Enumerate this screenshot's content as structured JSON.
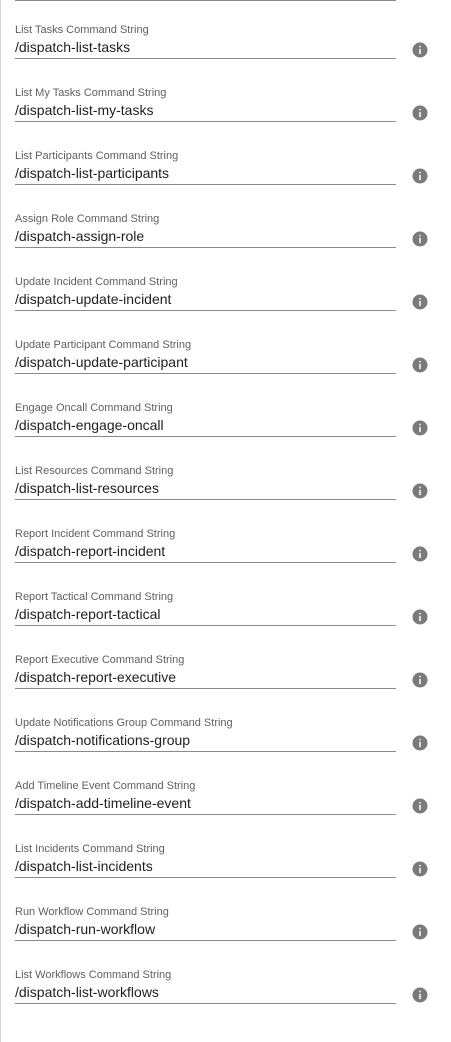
{
  "fields": [
    {
      "label": "List Tasks Command String",
      "value": "/dispatch-list-tasks"
    },
    {
      "label": "List My Tasks Command String",
      "value": "/dispatch-list-my-tasks"
    },
    {
      "label": "List Participants Command String",
      "value": "/dispatch-list-participants"
    },
    {
      "label": "Assign Role Command String",
      "value": "/dispatch-assign-role"
    },
    {
      "label": "Update Incident Command String",
      "value": "/dispatch-update-incident"
    },
    {
      "label": "Update Participant Command String",
      "value": "/dispatch-update-participant"
    },
    {
      "label": "Engage Oncall Command String",
      "value": "/dispatch-engage-oncall"
    },
    {
      "label": "List Resources Command String",
      "value": "/dispatch-list-resources"
    },
    {
      "label": "Report Incident Command String",
      "value": "/dispatch-report-incident"
    },
    {
      "label": "Report Tactical Command String",
      "value": "/dispatch-report-tactical"
    },
    {
      "label": "Report Executive Command String",
      "value": "/dispatch-report-executive"
    },
    {
      "label": "Update Notifications Group Command String",
      "value": "/dispatch-notifications-group"
    },
    {
      "label": "Add Timeline Event Command String",
      "value": "/dispatch-add-timeline-event"
    },
    {
      "label": "List Incidents Command String",
      "value": "/dispatch-list-incidents"
    },
    {
      "label": "Run Workflow Command String",
      "value": "/dispatch-run-workflow"
    },
    {
      "label": "List Workflows Command String",
      "value": "/dispatch-list-workflows"
    }
  ],
  "info_icon": "info-circle-icon",
  "colors": {
    "label": "#5f5f5f",
    "text": "#1f1f1f",
    "underline": "#8a8a8a",
    "icon": "#7a7a7a"
  }
}
